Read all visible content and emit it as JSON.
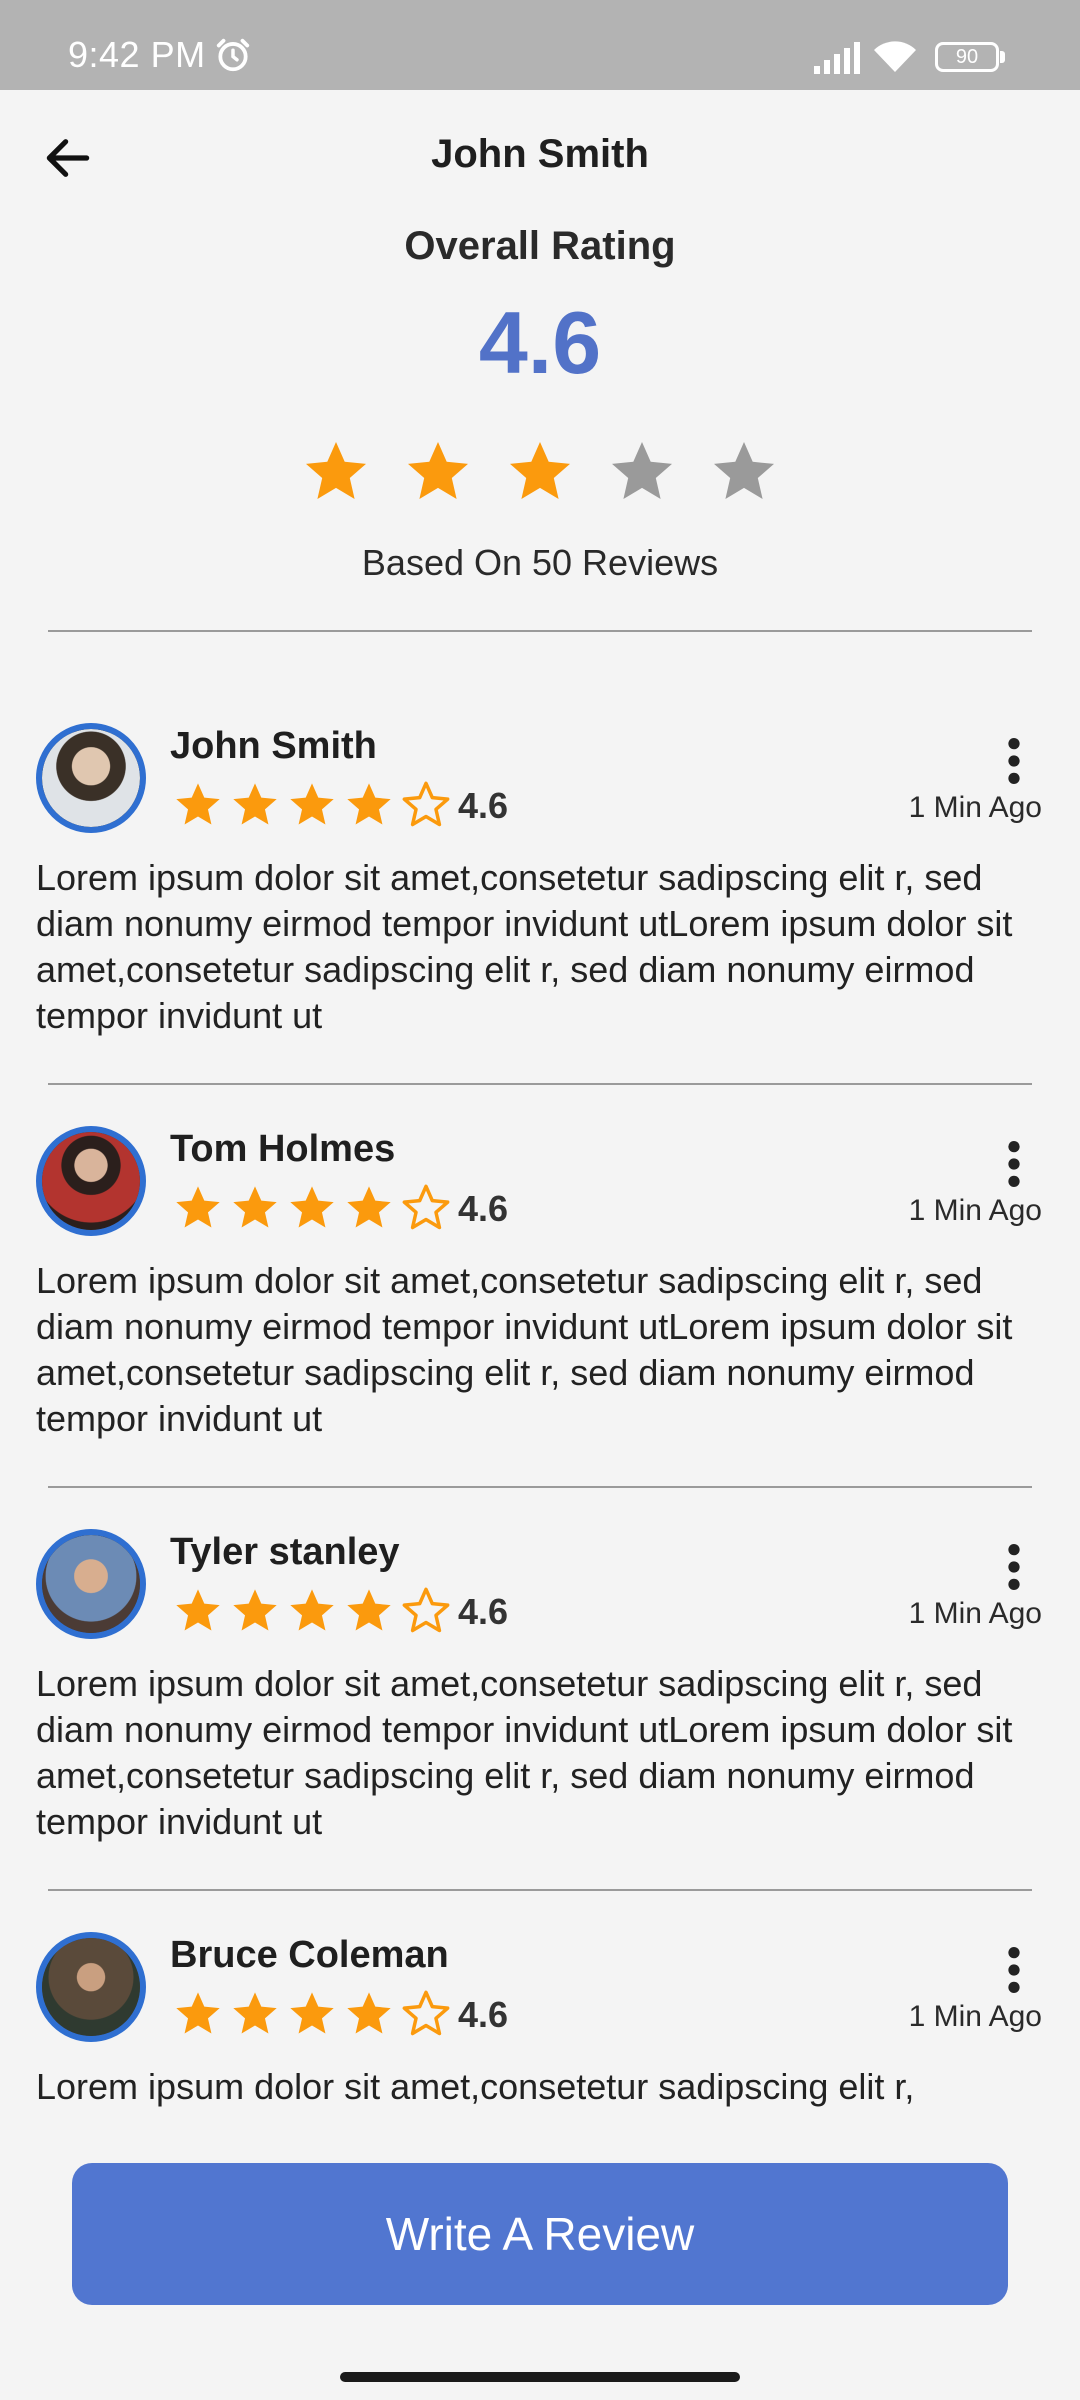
{
  "status_bar": {
    "time": "9:42 PM",
    "battery": "90",
    "icons": [
      "alarm-icon",
      "signal-icon",
      "wifi-icon",
      "battery-icon"
    ]
  },
  "header": {
    "title": "John Smith",
    "back_icon": "arrow-left-icon"
  },
  "summary": {
    "label": "Overall Rating",
    "value": "4.6",
    "stars_filled": 3,
    "stars_total": 5,
    "based_on": "Based On 50 Reviews"
  },
  "reviews": [
    {
      "name": "John Smith",
      "rating": "4.6",
      "stars_filled": 4,
      "time": "1 Min Ago",
      "text": "Lorem ipsum dolor sit amet,consetetur sadipscing elit r, sed diam nonumy eirmod tempor invidunt utLorem ipsum dolor sit amet,consetetur sadipscing elit r, sed diam nonumy eirmod tempor invidunt ut"
    },
    {
      "name": "Tom Holmes",
      "rating": "4.6",
      "stars_filled": 4,
      "time": "1 Min Ago",
      "text": "Lorem ipsum dolor sit amet,consetetur sadipscing elit r, sed diam nonumy eirmod tempor invidunt utLorem ipsum dolor sit amet,consetetur sadipscing elit r, sed diam nonumy eirmod tempor invidunt ut"
    },
    {
      "name": "Tyler stanley",
      "rating": "4.6",
      "stars_filled": 4,
      "time": "1 Min Ago",
      "text": "Lorem ipsum dolor sit amet,consetetur sadipscing elit r, sed diam nonumy eirmod tempor invidunt utLorem ipsum dolor sit amet,consetetur sadipscing elit r, sed diam nonumy eirmod tempor invidunt ut"
    },
    {
      "name": "Bruce Coleman",
      "rating": "4.6",
      "stars_filled": 4,
      "time": "1 Min Ago",
      "text": "Lorem ipsum dolor sit amet,consetetur sadipscing elit r,"
    }
  ],
  "write_review_button": "Write A Review",
  "colors": {
    "accent": "#5272c8",
    "button": "#5176d0",
    "star_filled": "#fb9a0d",
    "star_empty_summary": "#9a9a9a",
    "avatar_ring": "#2f6fd1"
  }
}
